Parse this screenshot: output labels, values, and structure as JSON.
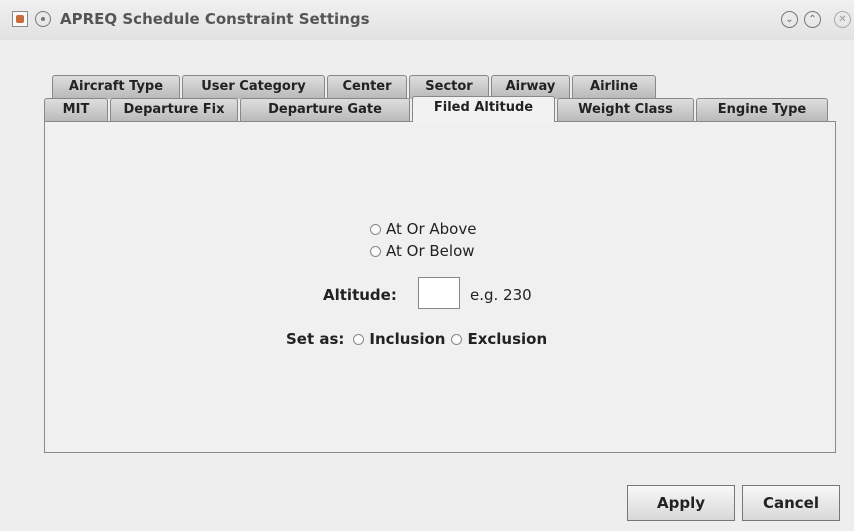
{
  "window": {
    "title": "APREQ Schedule Constraint Settings"
  },
  "tabs": {
    "row_back": [
      "Aircraft Type",
      "User Category",
      "Center",
      "Sector",
      "Airway",
      "Airline"
    ],
    "row_front": [
      "MIT",
      "Departure Fix",
      "Departure Gate",
      "Filed Altitude",
      "Weight Class",
      "Engine Type"
    ],
    "selected": "Filed Altitude"
  },
  "form": {
    "options": [
      "At Or Above",
      "At Or Below"
    ],
    "altitude_label": "Altitude:",
    "altitude_value": "",
    "altitude_hint": "e.g. 230",
    "set_as_label": "Set as:",
    "set_as_options": [
      "Inclusion",
      "Exclusion"
    ]
  },
  "buttons": {
    "apply": "Apply",
    "cancel": "Cancel"
  }
}
